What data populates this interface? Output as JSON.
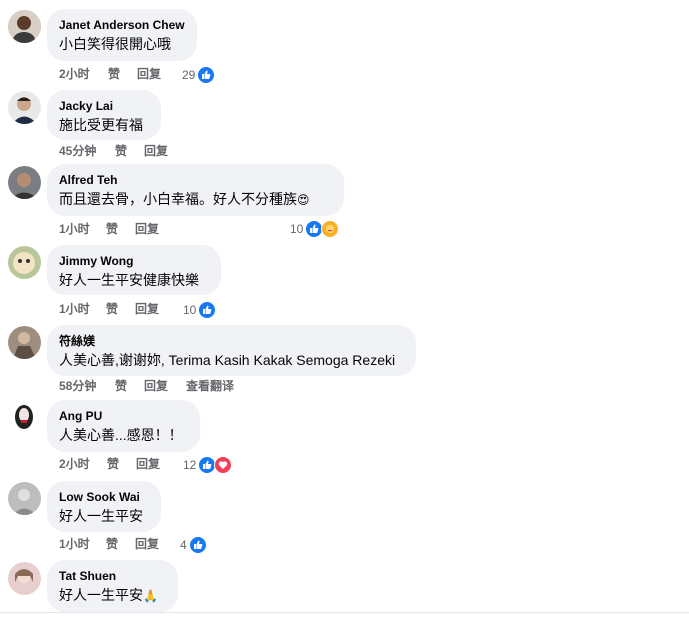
{
  "colors": {
    "bubble": "#f0f2f5",
    "muted": "#65676b",
    "like": "#1877f2",
    "love": "#f33e58"
  },
  "comments": [
    {
      "author": "Janet Anderson Chew",
      "text": "小白笑得很開心哦",
      "time": "2小时",
      "like": "赞",
      "reply": "回复",
      "count": "29",
      "reactions": [
        "like"
      ]
    },
    {
      "author": "Jacky Lai",
      "text": "施比受更有福",
      "time": "45分钟",
      "like": "赞",
      "reply": "回复"
    },
    {
      "author": "Alfred Teh",
      "text": "而且還去骨，小白幸福。好人不分種族",
      "emoji": "😍",
      "time": "1小时",
      "like": "赞",
      "reply": "回复",
      "count": "10",
      "reactions": [
        "like",
        "care"
      ]
    },
    {
      "author": "Jimmy Wong",
      "text": "好人一生平安健康快樂",
      "time": "1小时",
      "like": "赞",
      "reply": "回复",
      "count": "10",
      "reactions": [
        "like"
      ]
    },
    {
      "author": "符絲媄",
      "text": "人美心善,谢谢妳, Terima Kasih Kakak Semoga Rezeki",
      "time": "58分钟",
      "like": "赞",
      "reply": "回复",
      "translate": "查看翻译"
    },
    {
      "author": "Ang PU",
      "text": "人美心善...感恩！！",
      "time": "2小时",
      "like": "赞",
      "reply": "回复",
      "count": "12",
      "reactions": [
        "like",
        "love"
      ]
    },
    {
      "author": "Low Sook Wai",
      "text": "好人一生平安",
      "time": "1小时",
      "like": "赞",
      "reply": "回复",
      "count": "4",
      "reactions": [
        "like"
      ]
    },
    {
      "author": "Tat Shuen",
      "text": "好人一生平安",
      "emoji": "🙏"
    }
  ]
}
